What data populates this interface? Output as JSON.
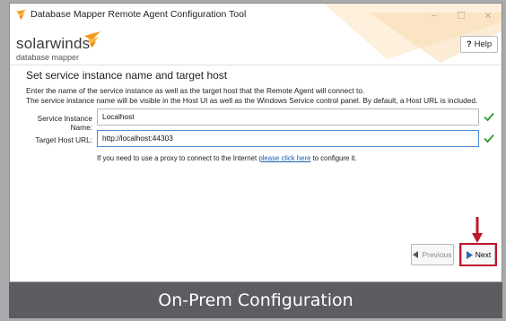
{
  "window": {
    "title": "Database Mapper Remote Agent Configuration Tool",
    "minimize_glyph": "–",
    "maximize_glyph": "☐",
    "close_glyph": "✕"
  },
  "header": {
    "logo_text": "solarwinds",
    "logo_sub": "database mapper",
    "help_mark": "?",
    "help_label": "Help"
  },
  "section": {
    "title": "Set service instance name and target host",
    "desc_line1": "Enter the name of the service instance as well as the target host that the Remote Agent will connect to.",
    "desc_line2": "The service instance name will be visible in the Host UI as well as the Windows Service control panel. By default, a Host URL is included."
  },
  "form": {
    "instance_label": "Service Instance Name:",
    "instance_value": "Localhost",
    "host_label": "Target Host URL:",
    "host_value": "http://localhost:44303",
    "proxy_text_before": "If you need to use a proxy to connect to the Internet",
    "proxy_link": "please click here",
    "proxy_text_after": "to configure it."
  },
  "footer": {
    "previous_label": "Previous",
    "next_label": "Next"
  },
  "caption": "On-Prem Configuration",
  "colors": {
    "brand_orange": "#f29a1d",
    "check_green": "#2e9b2e",
    "highlight_red": "#c0182a",
    "caption_bg": "#5c5d60"
  },
  "icons": {
    "title": "solarwinds-flame-icon",
    "valid": "checkmark-icon",
    "previous": "chevron-left-icon",
    "next": "chevron-right-icon"
  }
}
